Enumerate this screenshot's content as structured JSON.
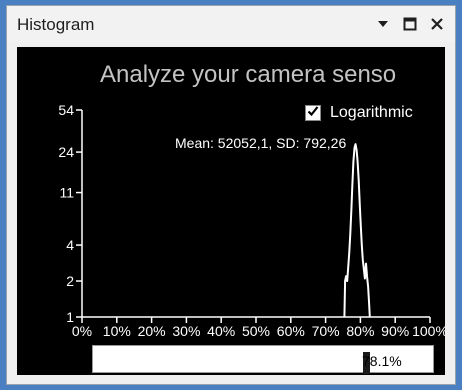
{
  "window": {
    "title": "Histogram"
  },
  "banner": "Analyze your camera senso",
  "logarithmic": {
    "label": "Logarithmic",
    "checked": true
  },
  "stats_text": "Mean: 52052,1, SD: 792,26",
  "range_value": "78.1%",
  "colors": {
    "plot_background": "#000000",
    "histogram": "#ffffff",
    "banner_text": "#c3c3c3"
  },
  "chart_data": {
    "type": "line",
    "log_scale_y": true,
    "y_ticks": [
      "54",
      "24",
      "11",
      "4",
      "2",
      "1"
    ],
    "x_ticks": [
      "0%",
      "10%",
      "20%",
      "30%",
      "40%",
      "50%",
      "60%",
      "70%",
      "80%",
      "90%",
      "100%"
    ],
    "x_range": [
      0,
      100
    ],
    "series": [
      {
        "x": [
          75.4,
          75.6,
          75.9,
          76.2,
          76.5,
          76.8,
          77.1,
          77.4,
          77.7,
          78.0,
          78.3,
          78.6,
          78.9,
          79.2,
          79.5,
          79.8,
          80.1,
          80.4,
          80.7,
          81.0,
          81.3,
          81.6,
          81.9,
          82.2,
          82.5,
          82.7
        ],
        "y": [
          1,
          2,
          2.2,
          2,
          2.6,
          3.5,
          5,
          8,
          13,
          20,
          26,
          28,
          25,
          20,
          14,
          9,
          6,
          4,
          3,
          2.5,
          2.1,
          2.8,
          2.2,
          1.8,
          1.3,
          1
        ]
      }
    ]
  }
}
